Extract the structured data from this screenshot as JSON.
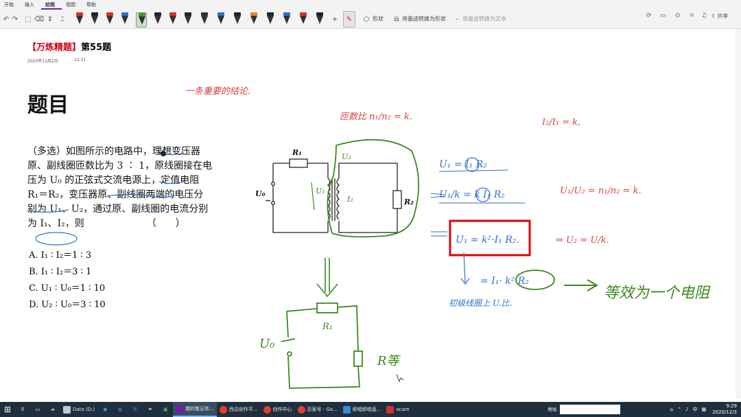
{
  "ribbon": {
    "tabs": [
      "开始",
      "插入",
      "绘图",
      "视图",
      "帮助"
    ],
    "active_tab": "绘图",
    "shape_label": "形状",
    "ink_to_shape_label": "将墨迹转换为形状",
    "ink_to_text_label": "将墨迹转换为文本",
    "share_label": "共享"
  },
  "page": {
    "header_bracket_open": "【",
    "header_brand": "万炼精题",
    "header_bracket_close": "】",
    "header_rest": "第55题",
    "date": "2020年12月2日",
    "time": "12:31",
    "title": "题目"
  },
  "problem": {
    "lines": [
      "（多选）如图所示的电路中，理想变压器",
      "原、副线圈匝数比为 3 ∶ 1，原线圈接在电",
      "压为 U₀ 的正弦式交流电源上，定值电阻",
      "R₁＝R₂，变压器原、副线圈两端的电压分",
      "别为 U₁、U₂，通过原、副线圈的电流分别",
      "为 I₁、I₂，则　　　　　　　（　　）"
    ],
    "options": [
      "A. I₁ ∶ I₂＝1 ∶ 3",
      "B. I₁ ∶ I₂＝3 ∶ 1",
      "C. U₁ ∶ U₀＝1 ∶ 10",
      "D. U₂ ∶ U₀＝3 ∶ 10"
    ]
  },
  "circuit": {
    "r1": "R₁",
    "r2": "R₂",
    "u0": "U₀",
    "u2": "U₂",
    "u1": "U₁",
    "i2": "I₂"
  },
  "handwriting": {
    "note_top": "一条重要的结论.",
    "turns_ratio": "匝数比 n₁/n₂ = k.",
    "current_ratio": "I₂/I₁ = k,",
    "eq1": "U₁ = I₁ R₂",
    "eq2": "U₁/k = k I₁ R₂",
    "eq3": "U₁ = k²·I₁ R₂.",
    "eq4": "= I₁· k²·R₂",
    "note_primary": "初级线圈上 U.比.",
    "voltage_ratio": "U₁/U₂ = n₁/n₂ = k.",
    "u2_formula": "⇒ U₂ = U/k.",
    "equiv": "等效为一个电阻",
    "lower_u0": "U₀",
    "lower_r1": "R₁",
    "lower_req": "R等"
  },
  "taskbar": {
    "items": [
      "Data (D:)",
      "我的笔记本...",
      "西瓜创作平...",
      "创作中心",
      "百家号 - Go...",
      "即唱即唱直...",
      "ocam"
    ],
    "address_label": "地址",
    "ime": "中",
    "time": "9:29",
    "date": "2020/12/3"
  },
  "colors": {
    "ink_red": "#d94040",
    "ink_blue": "#2f6fd6",
    "ink_green": "#3a8a1c",
    "box_red": "#e00000",
    "accent_purple": "#7719aa"
  }
}
